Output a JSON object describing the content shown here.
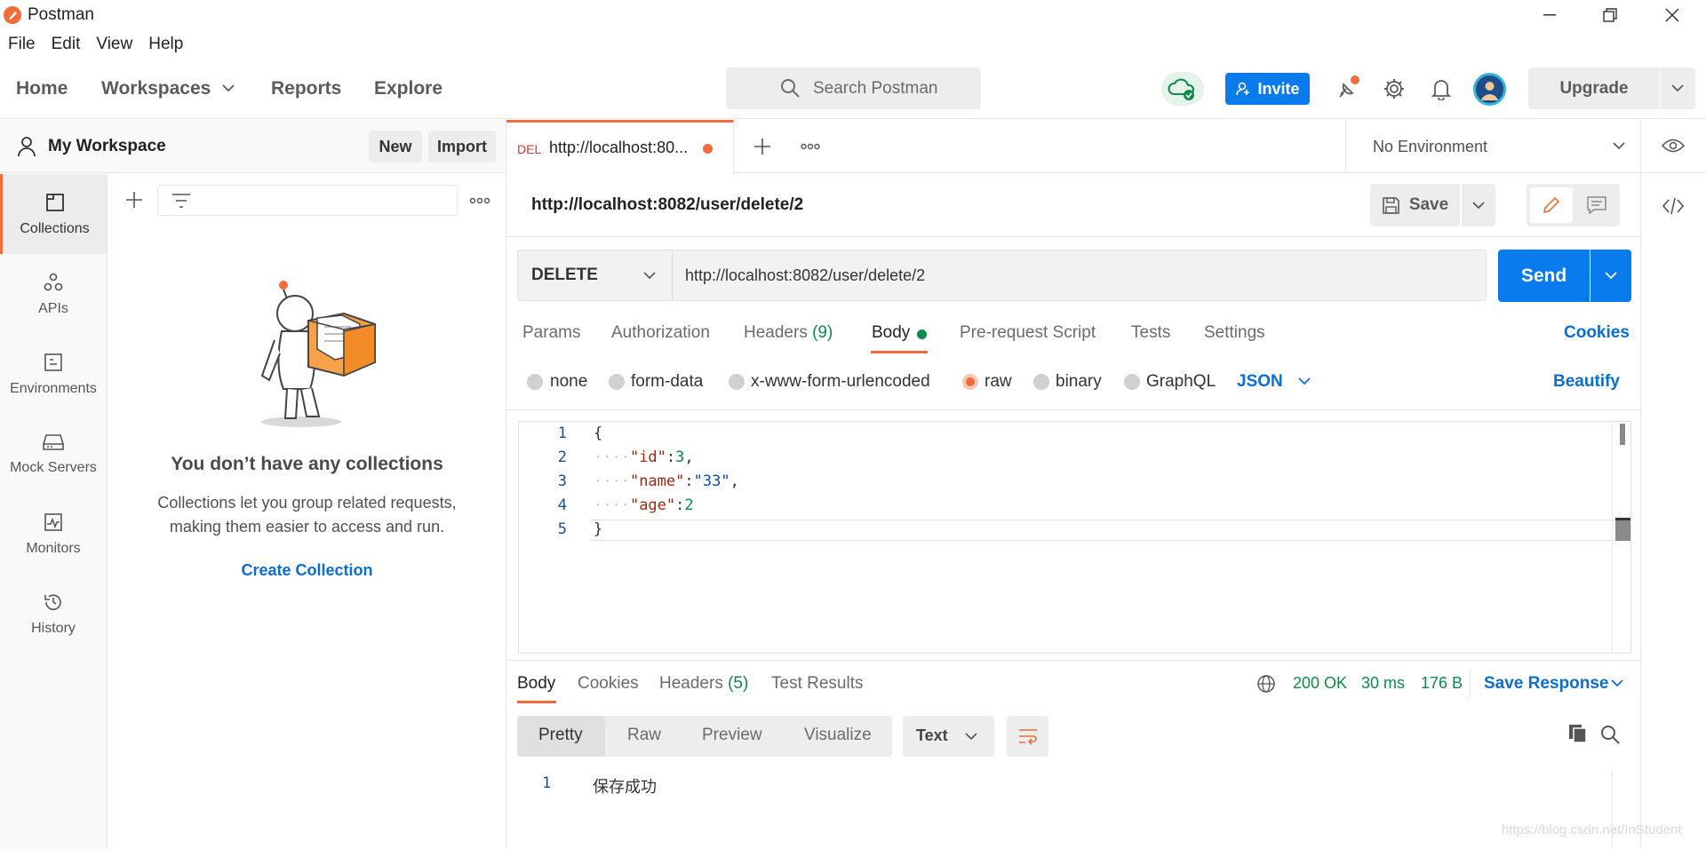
{
  "window": {
    "title": "Postman"
  },
  "menu": [
    "File",
    "Edit",
    "View",
    "Help"
  ],
  "header": {
    "nav": [
      "Home",
      "Workspaces",
      "Reports",
      "Explore"
    ],
    "search_placeholder": "Search Postman",
    "invite_label": "Invite",
    "upgrade_label": "Upgrade"
  },
  "sidebar": {
    "workspace_name": "My Workspace",
    "new_label": "New",
    "import_label": "Import",
    "rail": [
      "Collections",
      "APIs",
      "Environments",
      "Mock Servers",
      "Monitors",
      "History"
    ],
    "empty_title": "You don’t have any collections",
    "empty_desc": "Collections let you group related requests, making them easier to access and run.",
    "create_label": "Create Collection"
  },
  "tab": {
    "method": "DEL",
    "title": "http://localhost:80..."
  },
  "environment": "No Environment",
  "request": {
    "name": "http://localhost:8082/user/delete/2",
    "save_label": "Save",
    "method": "DELETE",
    "url": "http://localhost:8082/user/delete/2",
    "send_label": "Send",
    "subtabs": [
      "Params",
      "Authorization",
      "Headers",
      "Body",
      "Pre-request Script",
      "Tests",
      "Settings"
    ],
    "headers_count": "(9)",
    "cookies_label": "Cookies",
    "body_types": [
      "none",
      "form-data",
      "x-www-form-urlencoded",
      "raw",
      "binary",
      "GraphQL"
    ],
    "selected_body_type": "raw",
    "raw_format": "JSON",
    "beautify_label": "Beautify",
    "code_lines": [
      {
        "n": "1",
        "text": "{"
      },
      {
        "n": "2",
        "key": "\"id\"",
        "value": "3",
        "suffix": ","
      },
      {
        "n": "3",
        "key": "\"name\"",
        "value": "\"33\"",
        "suffix": ","
      },
      {
        "n": "4",
        "key": "\"age\"",
        "value": "2",
        "suffix": ""
      },
      {
        "n": "5",
        "text": "}"
      }
    ]
  },
  "response": {
    "tabs": [
      "Body",
      "Cookies",
      "Headers",
      "Test Results"
    ],
    "headers_count": "(5)",
    "status": "200 OK",
    "time": "30 ms",
    "size": "176 B",
    "save_label": "Save Response",
    "views": [
      "Pretty",
      "Raw",
      "Preview",
      "Visualize"
    ],
    "format": "Text",
    "line_no": "1",
    "body_text": "保存成功"
  },
  "watermark": "https://blog.csdn.net/InStudent",
  "colors": {
    "accent": "#f26b3a",
    "primary": "#097bed",
    "link": "#0b6ed1",
    "success": "#0f8a48"
  }
}
